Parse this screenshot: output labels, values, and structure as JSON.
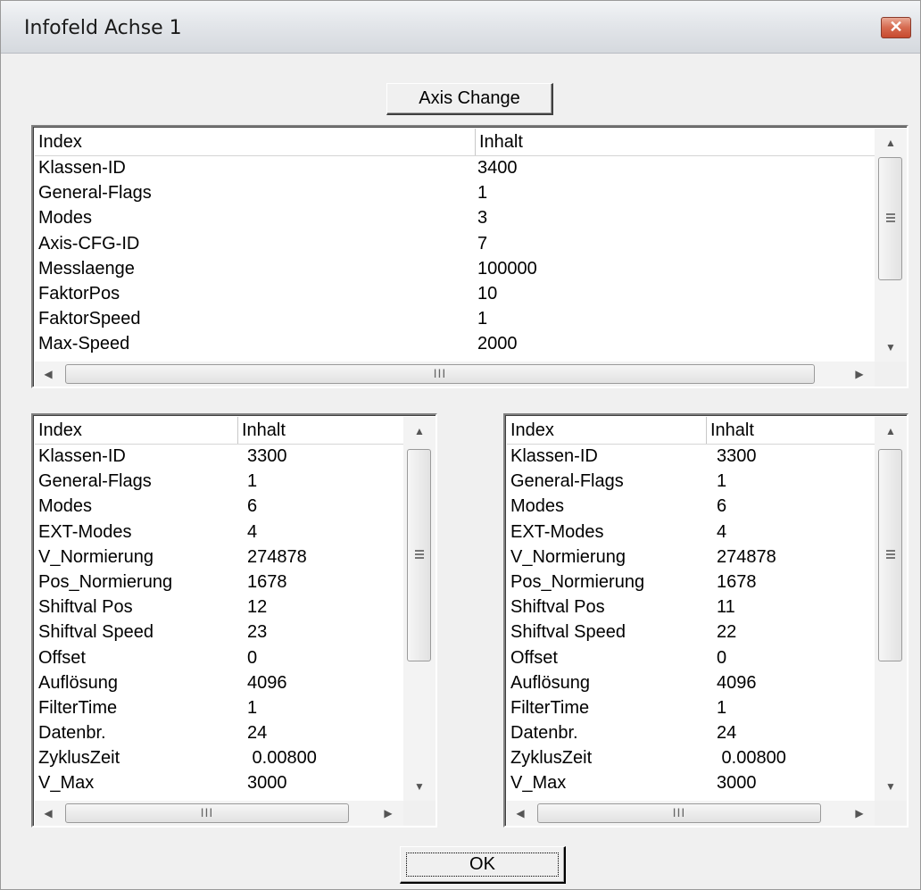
{
  "window": {
    "title": "Infofeld Achse 1",
    "close_glyph": "✕"
  },
  "axis_change_label": "Axis Change",
  "ok_label": "OK",
  "columns": {
    "index": "Index",
    "content": "Inhalt"
  },
  "scroll_glyphs": {
    "up": "▲",
    "down": "▼",
    "left": "◀",
    "right": "▶",
    "grip": "III"
  },
  "top_list": {
    "rows": [
      {
        "index": "Klassen-ID",
        "content": "3400"
      },
      {
        "index": "General-Flags",
        "content": "1"
      },
      {
        "index": "Modes",
        "content": "3"
      },
      {
        "index": "Axis-CFG-ID",
        "content": "7"
      },
      {
        "index": "Messlaenge",
        "content": "100000"
      },
      {
        "index": "FaktorPos",
        "content": "10"
      },
      {
        "index": "FaktorSpeed",
        "content": "1"
      },
      {
        "index": "Max-Speed",
        "content": "2000"
      }
    ]
  },
  "left_list": {
    "rows": [
      {
        "index": "Klassen-ID",
        "content": "3300"
      },
      {
        "index": "General-Flags",
        "content": "1"
      },
      {
        "index": "Modes",
        "content": "6"
      },
      {
        "index": "EXT-Modes",
        "content": "4"
      },
      {
        "index": "V_Normierung",
        "content": "274878"
      },
      {
        "index": "Pos_Normierung",
        "content": "1678"
      },
      {
        "index": "Shiftval Pos",
        "content": "12"
      },
      {
        "index": "Shiftval Speed",
        "content": "23"
      },
      {
        "index": "Offset",
        "content": "0"
      },
      {
        "index": "Auflösung",
        "content": "4096"
      },
      {
        "index": "FilterTime",
        "content": "1"
      },
      {
        "index": "Datenbr.",
        "content": "24"
      },
      {
        "index": "ZyklusZeit",
        "content": " 0.00800"
      },
      {
        "index": "V_Max",
        "content": "3000"
      }
    ]
  },
  "right_list": {
    "rows": [
      {
        "index": "Klassen-ID",
        "content": "3300"
      },
      {
        "index": "General-Flags",
        "content": "1"
      },
      {
        "index": "Modes",
        "content": "6"
      },
      {
        "index": "EXT-Modes",
        "content": "4"
      },
      {
        "index": "V_Normierung",
        "content": "274878"
      },
      {
        "index": "Pos_Normierung",
        "content": "1678"
      },
      {
        "index": "Shiftval Pos",
        "content": "11"
      },
      {
        "index": "Shiftval Speed",
        "content": "22"
      },
      {
        "index": "Offset",
        "content": "0"
      },
      {
        "index": "Auflösung",
        "content": "4096"
      },
      {
        "index": "FilterTime",
        "content": "1"
      },
      {
        "index": "Datenbr.",
        "content": "24"
      },
      {
        "index": "ZyklusZeit",
        "content": " 0.00800"
      },
      {
        "index": "V_Max",
        "content": "3000"
      }
    ]
  }
}
